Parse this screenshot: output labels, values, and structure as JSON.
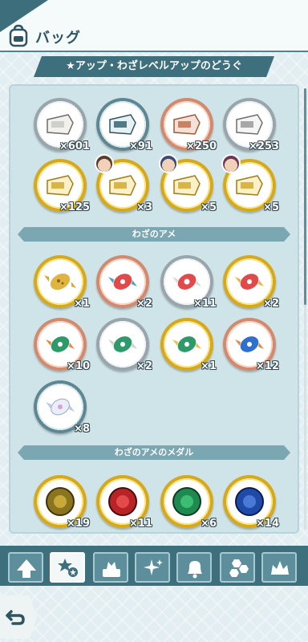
{
  "header": {
    "title": "バッグ",
    "icon": "backpack-icon"
  },
  "subtitle": "★アップ・わざレベルアップのどうぐ",
  "sections": {
    "candy": "わざのアメ",
    "medal": "わざのアメのメダル"
  },
  "tickets": [
    {
      "count": "×601",
      "ring": "silver"
    },
    {
      "count": "×91",
      "ring": "teal"
    },
    {
      "count": "×250",
      "ring": "bronze"
    },
    {
      "count": "×253",
      "ring": "silver"
    },
    {
      "count": "×125",
      "ring": "gold"
    },
    {
      "count": "×3",
      "ring": "gold"
    },
    {
      "count": "×5",
      "ring": "gold"
    },
    {
      "count": "×5",
      "ring": "gold"
    }
  ],
  "candies": [
    {
      "count": "×1",
      "ring": "gold"
    },
    {
      "count": "×2",
      "ring": "bronze"
    },
    {
      "count": "×11",
      "ring": "silver"
    },
    {
      "count": "×2",
      "ring": "gold"
    },
    {
      "count": "×10",
      "ring": "bronze"
    },
    {
      "count": "×2",
      "ring": "silver"
    },
    {
      "count": "×1",
      "ring": "gold"
    },
    {
      "count": "×12",
      "ring": "bronze"
    },
    {
      "count": "×8",
      "ring": "teal"
    }
  ],
  "medals": [
    {
      "count": "×19",
      "ring": "gold"
    },
    {
      "count": "×11",
      "ring": "gold"
    },
    {
      "count": "×6",
      "ring": "gold"
    },
    {
      "count": "×14",
      "ring": "gold"
    }
  ],
  "tabs": [
    "arrow-up-icon",
    "star-icon",
    "cake-icon",
    "sparkle-icon",
    "bell-icon",
    "hexagon-icon",
    "crown-icon"
  ],
  "back_icon": "return-arrow-icon",
  "colors": {
    "header": "#3e6f7d",
    "section": "#7aa7b2",
    "panel": "#cfe4e8"
  }
}
